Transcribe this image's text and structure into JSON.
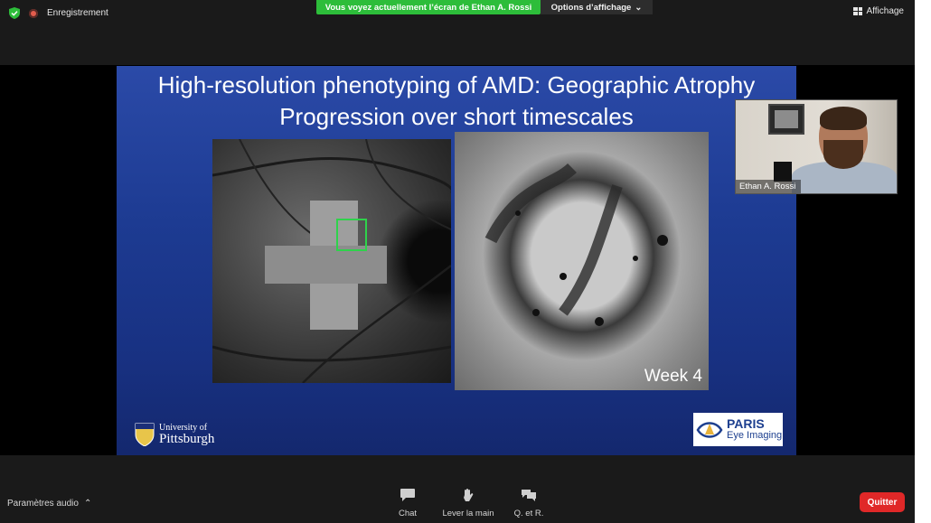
{
  "topbar": {
    "recording_label": "Enregistrement",
    "share_banner": "Vous voyez actuellement l’écran de Ethan A. Rossi",
    "options_label": "Options d’affichage",
    "view_label": "Affichage"
  },
  "slide": {
    "title_line1": "High-resolution phenotyping of AMD: Geographic Atrophy",
    "title_line2": "Progression over short timescales",
    "image_label": "Week 4",
    "logo_left_line1": "University of",
    "logo_left_line2": "Pittsburgh",
    "logo_right_line1": "PARIS",
    "logo_right_line2": "Eye Imaging"
  },
  "participant": {
    "name": "Ethan A. Rossi"
  },
  "bottombar": {
    "audio_label": "Paramètres audio",
    "chat_label": "Chat",
    "raise_hand_label": "Lever la main",
    "qa_label": "Q. et R.",
    "quit_label": "Quitter"
  },
  "colors": {
    "share_banner": "#2dbd3a",
    "quit_button": "#e02828",
    "slide_bg": "#1d3b92",
    "recording_dot": "#e25c4d"
  }
}
